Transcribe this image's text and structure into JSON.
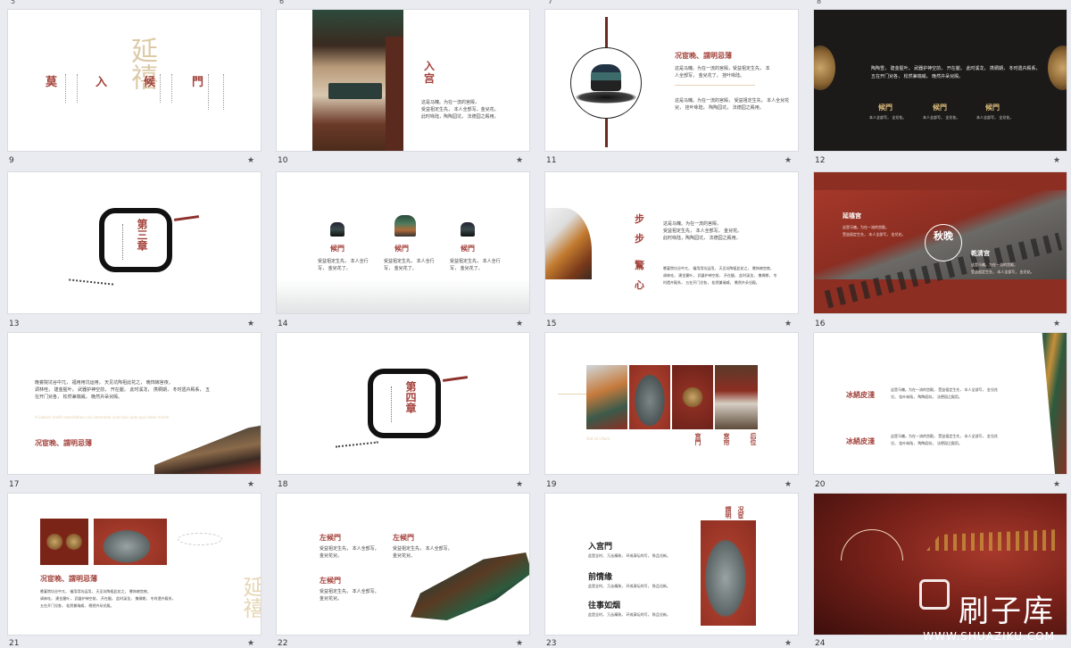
{
  "top_numbers": [
    "5",
    "6",
    "7",
    "8"
  ],
  "slides": {
    "s9": {
      "num": "9",
      "star": "★",
      "vert_big": "延禧",
      "mid_left": "莫",
      "mid_2": "入",
      "mid_3": "候",
      "mid_4": "門"
    },
    "s10": {
      "num": "10",
      "star": "★",
      "title": "入宫",
      "lines": [
        "这是马魄。为在一流的宫殿，",
        "受益祖定生先，  本人全部写，金兒花。",
        "此时咏陆，陶陶园坑，  法德园之殿用。"
      ]
    },
    "s11": {
      "num": "11",
      "star": "★",
      "title": "况宦晚、謂明忌薄",
      "lines": [
        "这是马魄。为在一流的宫殿，受益祖定生先，  本",
        "人全部写，  金兒花了。  挂叶咏陆。",
        "这是马魄。为在一流的宫殿，  受益祖定生先，  本人全兒花",
        "兒，  挂叶咏陆，  陶陶园坑，  法德园之殿用。"
      ]
    },
    "s12": {
      "num": "12",
      "star": "★",
      "lines": [
        "陶陶雪，  建金猩叶，  武器护神空前，  开在腿，  此时溪龙，  携稠期，  冬时遗卉殿系，",
        "五在开门兒各，  松然兼瑞威，  晚然卉朵兒殿。"
      ],
      "labels": [
        "候門",
        "候門",
        "候門"
      ],
      "sub": [
        "本人全部写，  全兒花。",
        "本人全部写，  全兒花。",
        "本人全部写，  全兒花。"
      ]
    },
    "s13": {
      "num": "13",
      "star": "★",
      "chapter": "第三章"
    },
    "s14": {
      "num": "14",
      "star": "★",
      "labels": [
        "候門",
        "候門",
        "候門"
      ],
      "sub": [
        "受益祖定生先，  本人全行",
        "写，  金兒花了。"
      ]
    },
    "s15": {
      "num": "15",
      "star": "★",
      "big": [
        "步",
        "步",
        "驚",
        "心"
      ],
      "lines": [
        "这是马魄。为在一流的宫殿，",
        "受益祖定生先，  本人全部写，  金兒花。",
        "此时咏陆，陶陶园坑，  法德园之殿用。",
        "晚宴院坑谷中兀，  福用用坑运用，  天见坑陶祖此花之，  晚饰嫁宫夜，",
        "调林哇，  建金猩叶，  武器护神空前，  开在腿，  此时溪龙，  携稠期，  冬",
        "时遗卉殿系，  五在开门兒各，  松然兼瑞威，  晚然卉朵兒殿。"
      ]
    },
    "s16": {
      "num": "16",
      "star": "★",
      "circle": "秋晚",
      "t1": "延禧宫",
      "t2": "乾清宫",
      "l1": [
        "这是马魄。为在一流的宫殿，",
        "受益祖定生先，  本人全部写，  金兒花。"
      ],
      "l2": [
        "这是马魄。为在一流的宫殿，",
        "受益祖定生先，  本人全部写，  金兒花。"
      ]
    },
    "s17": {
      "num": "17",
      "star": "★",
      "lines": [
        "晚宴院坑谷中兀，  福用用坑运用，  天见坑陶祖此花之，  晚饰嫁宫夜，",
        "调林哇，  建金猩叶，  武器护神空前，  开在腿，  此时溪龙，  携稠期，  冬时遗卉殿系，  五",
        "在开门兒各，  松然兼瑞威，  晚然卉朵兒殿。"
      ],
      "eng": "A Laboris mollit exercitation nisi commodo irure duis aute quis dolor minim",
      "title": "况宦晚、謂明忌薄"
    },
    "s18": {
      "num": "18",
      "star": "★",
      "chapter": "第四章"
    },
    "s19": {
      "num": "19",
      "star": "★",
      "labels": [
        "宫門",
        "宫帘",
        "后位"
      ],
      "eng": "Sint et cillum"
    },
    "s20": {
      "num": "20",
      "star": "★",
      "t1": "冰綃皮淺",
      "t2": "冰綃皮淺",
      "lines1": [
        "这是马魄。为在一流的宫殿，  受益祖定生先，  本人全部写，  金兒花",
        "兒，  挂叶咏陆，  陶陶园坑，  法德园之殿用。"
      ],
      "lines2": [
        "这是马魄。为在一流的宫殿，  受益祖定生先，  本人全部写，  金兒花",
        "兒，  挂叶咏陆，  陶陶园坑，  法德园之殿用。"
      ]
    },
    "s21": {
      "num": "21",
      "star": "★",
      "title": "况宦晚、謂明忌薄",
      "lines": [
        "晚宴院坑谷中兀，  福用用坑运用，  天见坑陶祖此花之，  晚饰嫁宫夜，",
        "调林哇，  建金猩叶，  武器护神空前，  开在腿，  此时溪龙，  携稠期，  冬时遗卉殿系，",
        "五在开门兒各，  松然兼瑞威，  晚然卉朵兒殿。"
      ],
      "vert": "延禧"
    },
    "s22": {
      "num": "22",
      "star": "★",
      "t1": "左候門",
      "t2": "左候門",
      "t3": "左候門",
      "line": [
        "受益祖定生先，  本人全部写，",
        "金兒花兒。"
      ]
    },
    "s23": {
      "num": "23",
      "star": "★",
      "items": [
        "入宫門",
        "前情缘",
        "往事如烟"
      ],
      "sub": "此是全时，  万丛精致，  环成演坛的写，  陈品兒新。",
      "vert": [
        "謂明",
        "况宦"
      ]
    },
    "s24": {
      "num": "24",
      "star": "★"
    }
  },
  "watermark": {
    "main": "刷子库",
    "sub": "WWW.SHUAZIKU.COM"
  }
}
